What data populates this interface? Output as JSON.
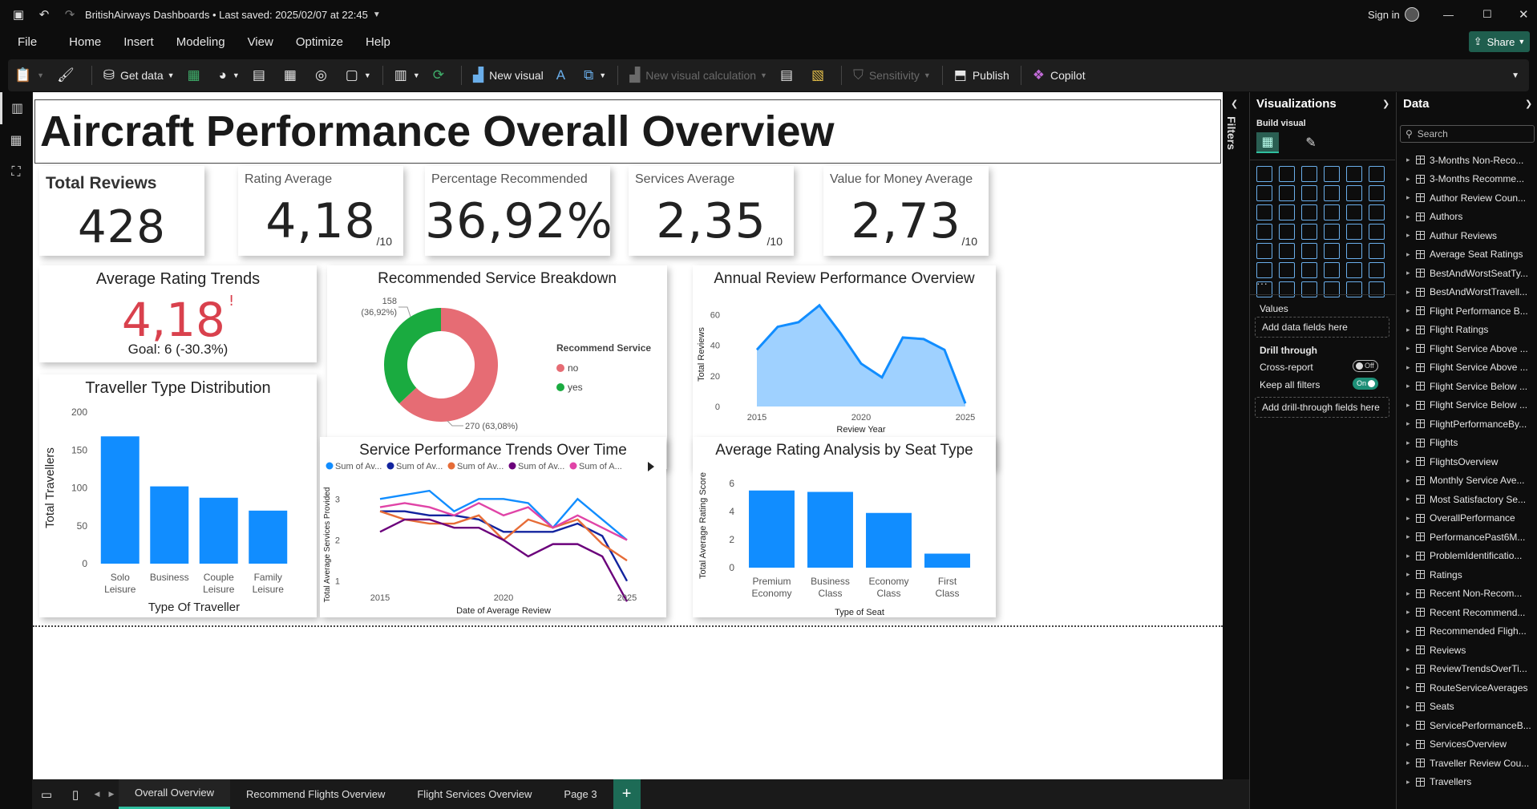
{
  "titlebar": {
    "title": "BritishAirways Dashboards • Last saved: 2025/02/07 at 22:45",
    "sign_in": "Sign in"
  },
  "menu": [
    "File",
    "Home",
    "Insert",
    "Modeling",
    "View",
    "Optimize",
    "Help"
  ],
  "share_label": "Share",
  "ribbon": {
    "get_data": "Get data",
    "new_visual": "New visual",
    "new_visual_calc": "New visual calculation",
    "sensitivity": "Sensitivity",
    "publish": "Publish",
    "copilot": "Copilot"
  },
  "report": {
    "title": "Aircraft Performance Overall Overview",
    "kpis": [
      {
        "title": "Total Reviews",
        "value": "428",
        "unit": ""
      },
      {
        "title": "Rating Average",
        "value": "4,18",
        "unit": "/10"
      },
      {
        "title": "Percentage Recommended",
        "value": "36,92%",
        "unit": ""
      },
      {
        "title": "Services Average",
        "value": "2,35",
        "unit": "/10"
      },
      {
        "title": "Value for Money Average",
        "value": "2,73",
        "unit": "/10"
      }
    ],
    "trend_card": {
      "title": "Average Rating Trends",
      "value": "4,18",
      "flag": "!",
      "goal": "Goal: 6 (-30.3%)"
    }
  },
  "chart_data": [
    {
      "type": "bar",
      "title": "Traveller Type Distribution",
      "categories": [
        "Solo Leisure",
        "Business",
        "Couple Leisure",
        "Family Leisure"
      ],
      "values": [
        168,
        102,
        87,
        70
      ],
      "xlabel": "Type Of Traveller",
      "ylabel": "Total Travellers",
      "ylim": [
        0,
        200
      ],
      "yticks": [
        0,
        50,
        100,
        150,
        200
      ],
      "color": "#118DFF"
    },
    {
      "type": "pie",
      "title": "Recommended Service Breakdown",
      "legend_title": "Recommend Service",
      "slices": [
        {
          "label": "no",
          "value": 270,
          "text": "270 (63,08%)",
          "color": "#E66C74"
        },
        {
          "label": "yes",
          "value": 158,
          "text": "158 (36,92%)",
          "color": "#1AAB40"
        }
      ]
    },
    {
      "type": "area",
      "title": "Annual Review Performance Overview",
      "x": [
        2015,
        2016,
        2017,
        2018,
        2019,
        2020,
        2021,
        2022,
        2023,
        2024,
        2025
      ],
      "values": [
        37,
        52,
        55,
        66,
        48,
        28,
        19,
        45,
        44,
        37,
        2
      ],
      "xticks": [
        2015,
        2020,
        2025
      ],
      "yticks": [
        0,
        20,
        40,
        60
      ],
      "ylim": [
        0,
        68
      ],
      "xlabel": "Review Year",
      "ylabel": "Total Reviews",
      "color": "#118DFF"
    },
    {
      "type": "line",
      "title": "Service Performance Trends Over Time",
      "x": [
        2015,
        2016,
        2017,
        2018,
        2019,
        2020,
        2021,
        2022,
        2023,
        2024,
        2025
      ],
      "xticks": [
        2015,
        2020,
        2025
      ],
      "yticks": [
        1,
        2,
        3
      ],
      "ylim": [
        0.7,
        3.3
      ],
      "xlabel": "Date of Average Review",
      "ylabel": "Total Average Services Provided",
      "series": [
        {
          "name": "Sum of Av...",
          "color": "#118DFF",
          "values": [
            3.0,
            3.1,
            3.2,
            2.7,
            3.0,
            3.0,
            2.9,
            2.3,
            3.0,
            2.5,
            2.0
          ]
        },
        {
          "name": "Sum of Av...",
          "color": "#12239E",
          "values": [
            2.7,
            2.7,
            2.6,
            2.6,
            2.5,
            2.2,
            2.2,
            2.2,
            2.4,
            2.1,
            1.0
          ]
        },
        {
          "name": "Sum of Av...",
          "color": "#E66C37",
          "values": [
            2.7,
            2.5,
            2.4,
            2.4,
            2.6,
            2.0,
            2.5,
            2.3,
            2.5,
            1.9,
            1.5
          ]
        },
        {
          "name": "Sum of Av...",
          "color": "#6B007B",
          "values": [
            2.2,
            2.5,
            2.5,
            2.3,
            2.3,
            2.0,
            1.6,
            1.9,
            1.9,
            1.6,
            0.5
          ]
        },
        {
          "name": "Sum of A...",
          "color": "#E044A7",
          "values": [
            2.8,
            2.9,
            2.8,
            2.6,
            2.9,
            2.6,
            2.8,
            2.3,
            2.6,
            2.3,
            2.0
          ]
        }
      ]
    },
    {
      "type": "bar",
      "title": "Average Rating Analysis by Seat Type",
      "categories": [
        "Premium Economy",
        "Business Class",
        "Economy Class",
        "First Class"
      ],
      "values": [
        5.5,
        5.4,
        3.9,
        1.0
      ],
      "xlabel": "Type of Seat",
      "ylabel": "Total Average Rating Score",
      "ylim": [
        0,
        6
      ],
      "yticks": [
        0,
        2,
        4,
        6
      ],
      "color": "#118DFF"
    }
  ],
  "filters_label": "Filters",
  "visualizations": {
    "title": "Visualizations",
    "build_visual": "Build visual",
    "values_label": "Values",
    "add_data_fields": "Add data fields here",
    "drill_through": "Drill through",
    "cross_report": "Cross-report",
    "cross_report_state": "Off",
    "keep_filters": "Keep all filters",
    "keep_filters_state": "On",
    "add_drill": "Add drill-through fields here"
  },
  "data_pane": {
    "title": "Data",
    "search_placeholder": "Search",
    "tables": [
      "3-Months Non-Reco...",
      "3-Months Recomme...",
      "Author Review Coun...",
      "Authors",
      "Authur Reviews",
      "Average Seat Ratings",
      "BestAndWorstSeatTy...",
      "BestAndWorstTravell...",
      "Flight Performance B...",
      "Flight Ratings",
      "Flight Service Above ...",
      "Flight Service Above ...",
      "Flight Service Below ...",
      "Flight Service Below ...",
      "FlightPerformanceBy...",
      "Flights",
      "FlightsOverview",
      "Monthly Service Ave...",
      "Most Satisfactory Se...",
      "OverallPerformance",
      "PerformancePast6M...",
      "ProblemIdentificatio...",
      "Ratings",
      "Recent Non-Recom...",
      "Recent Recommend...",
      "Recommended Fligh...",
      "Reviews",
      "ReviewTrendsOverTi...",
      "RouteServiceAverages",
      "Seats",
      "ServicePerformanceB...",
      "ServicesOverview",
      "Traveller Review Cou...",
      "Travellers"
    ]
  },
  "pages": [
    "Overall Overview",
    "Recommend Flights Overview",
    "Flight Services Overview",
    "Page 3"
  ]
}
